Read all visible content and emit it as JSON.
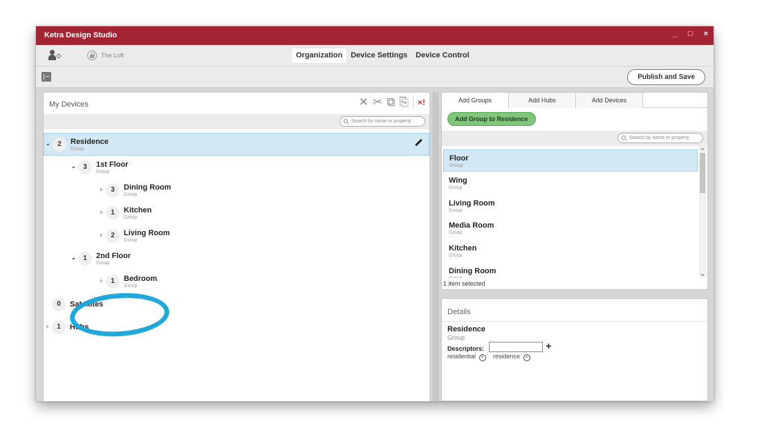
{
  "window": {
    "title": "Ketra Design Studio",
    "controls": {
      "minimize": "_",
      "maximize": "□",
      "close": "×"
    }
  },
  "nav": {
    "project_name": "The Loft",
    "tabs": [
      {
        "label": "Organization",
        "active": true
      },
      {
        "label": "Device Settings",
        "active": false
      },
      {
        "label": "Device Control",
        "active": false
      }
    ]
  },
  "toolbar": {
    "publish_label": "Publish and Save"
  },
  "left_panel": {
    "title": "My Devices",
    "tools": {
      "cut": "✕",
      "scissors": "✂",
      "copy": "⧉",
      "paste": "⎘",
      "remove": "×!"
    },
    "search_placeholder": "Search by name or property",
    "tree": [
      {
        "count": "2",
        "name": "Residence",
        "type": "Group",
        "expander": "open",
        "selected": true
      },
      {
        "count": "3",
        "name": "1st Floor",
        "type": "Group",
        "expander": "open"
      },
      {
        "count": "3",
        "name": "Dining Room",
        "type": "Group",
        "expander": "closed"
      },
      {
        "count": "1",
        "name": "Kitchen",
        "type": "Group",
        "expander": "closed"
      },
      {
        "count": "2",
        "name": "Living Room",
        "type": "Group",
        "expander": "closed"
      },
      {
        "count": "1",
        "name": "2nd Floor",
        "type": "Group",
        "expander": "open"
      },
      {
        "count": "1",
        "name": "Bedroom",
        "type": "Group",
        "expander": "closed"
      },
      {
        "count": "0",
        "name": "Satellites",
        "type": "",
        "expander": "none"
      },
      {
        "count": "1",
        "name": "Hubs",
        "type": "",
        "expander": "closed"
      }
    ],
    "highlight_color": "#1fa8d9"
  },
  "right_top": {
    "tabs": [
      {
        "label": "Add Groups",
        "active": true
      },
      {
        "label": "Add Hubs",
        "active": false
      },
      {
        "label": "Add Devices",
        "active": false
      }
    ],
    "add_button_label": "Add Group to Residence",
    "search_placeholder": "Search by name or property",
    "items": [
      {
        "name": "Floor",
        "type": "Group",
        "selected": true
      },
      {
        "name": "Wing",
        "type": "Group"
      },
      {
        "name": "Living Room",
        "type": "Group"
      },
      {
        "name": "Media Room",
        "type": "Group"
      },
      {
        "name": "Kitchen",
        "type": "Group"
      },
      {
        "name": "Dining Room",
        "type": "Group"
      }
    ],
    "status": "1 item selected"
  },
  "details": {
    "title": "Details",
    "name": "Residence",
    "type": "Group",
    "descriptors_label": "Descriptors:",
    "descriptors_value": "",
    "add_symbol": "+",
    "chips": [
      {
        "label": "residential",
        "remove": "×"
      },
      {
        "label": "residence",
        "remove": "×"
      }
    ]
  },
  "colors": {
    "titlebar": "#a32533",
    "selection": "#d2e8f5",
    "accent_green": "#7fc67a",
    "annotation": "#1fa8d9"
  }
}
